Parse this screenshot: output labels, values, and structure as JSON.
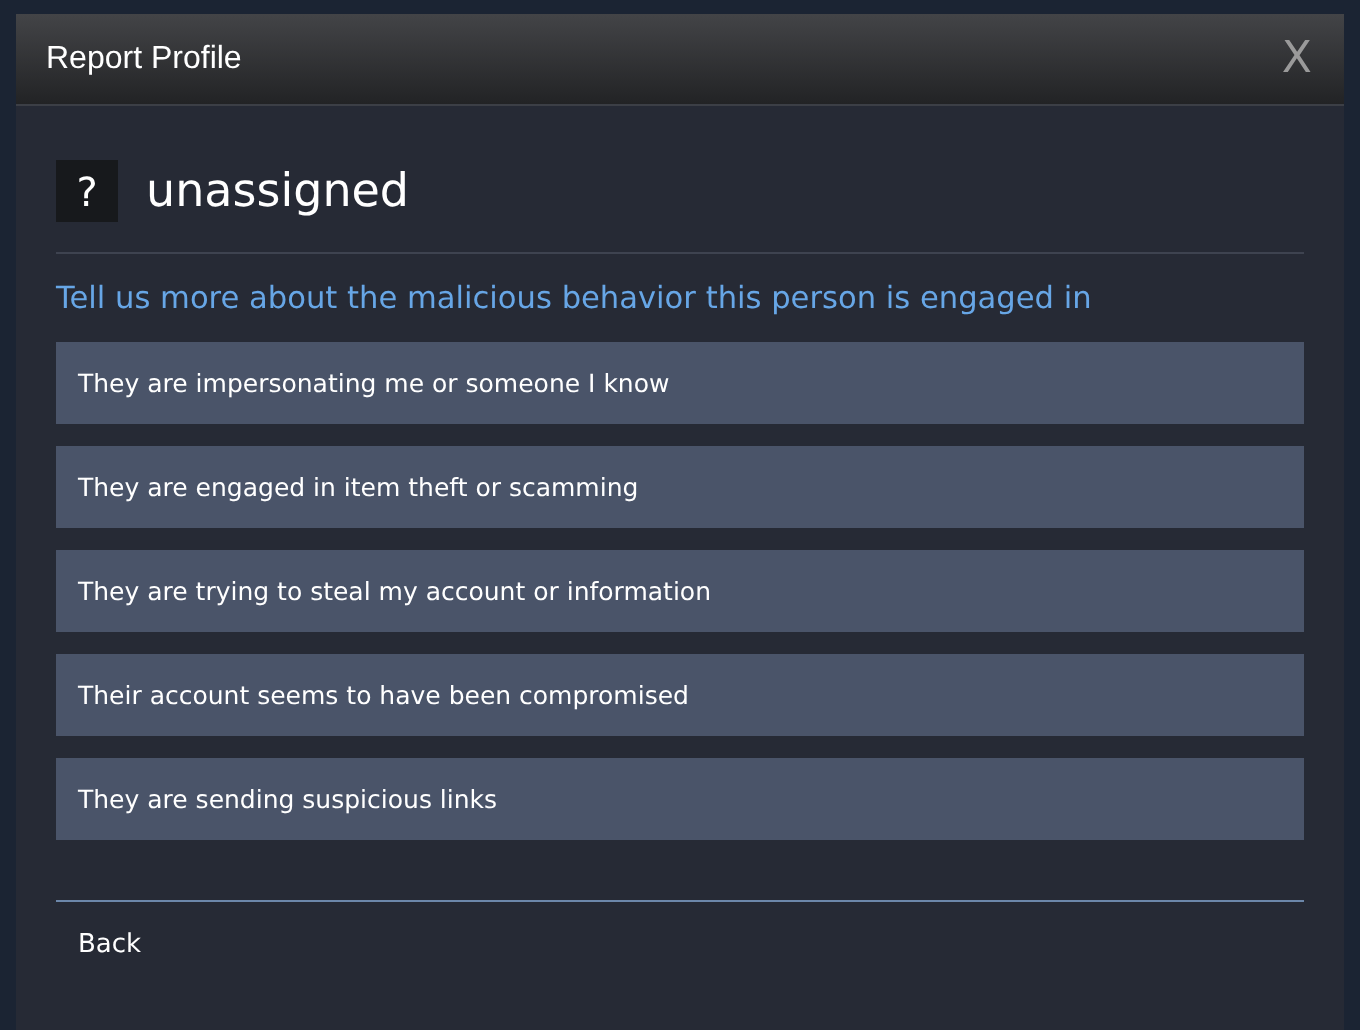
{
  "window": {
    "title": "Report Profile",
    "close": "X"
  },
  "profile": {
    "avatar": "?",
    "name": "unassigned"
  },
  "prompt": "Tell us more about the malicious behavior this person is engaged in",
  "options": [
    {
      "label": "They are impersonating me or someone I know"
    },
    {
      "label": "They are engaged in item theft or scamming"
    },
    {
      "label": "They are trying to steal my account or information"
    },
    {
      "label": "Their account seems to have been compromised"
    },
    {
      "label": "They are sending suspicious links"
    }
  ],
  "back": "Back"
}
